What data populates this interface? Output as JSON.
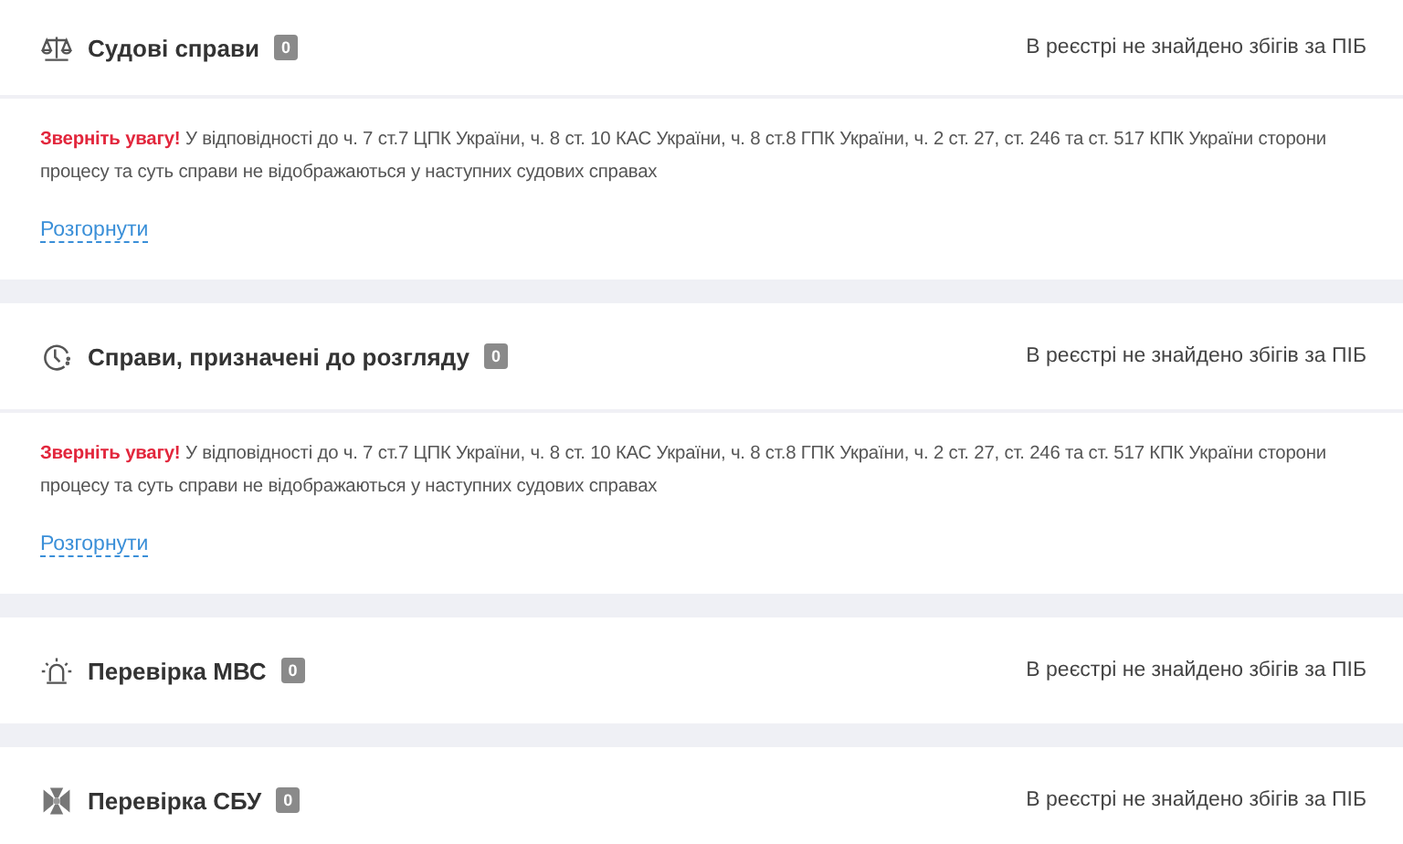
{
  "sections": [
    {
      "title": "Судові справи",
      "count": "0",
      "status": "В реєстрі не знайдено збігів за ПІБ",
      "notice": {
        "warning": "Зверніть увагу!",
        "text": "У відповідності до ч. 7 ст.7 ЦПК України, ч. 8 ст. 10 КАС України, ч. 8 ст.8 ГПК України, ч. 2 ст. 27, ст. 246 та ст. 517 КПК України сторони процесу та суть справи не відображаються у наступних судових справах"
      },
      "expand": "Розгорнути"
    },
    {
      "title": "Справи, призначені до розгляду",
      "count": "0",
      "status": "В реєстрі не знайдено збігів за ПІБ",
      "notice": {
        "warning": "Зверніть увагу!",
        "text": "У відповідності до ч. 7 ст.7 ЦПК України, ч. 8 ст. 10 КАС України, ч. 8 ст.8 ГПК України, ч. 2 ст. 27, ст. 246 та ст. 517 КПК України сторони процесу та суть справи не відображаються у наступних судових справах"
      },
      "expand": "Розгорнути"
    },
    {
      "title": "Перевірка МВС",
      "count": "0",
      "status": "В реєстрі не знайдено збігів за ПІБ"
    },
    {
      "title": "Перевірка СБУ",
      "count": "0",
      "status": "В реєстрі не знайдено збігів за ПІБ"
    }
  ]
}
